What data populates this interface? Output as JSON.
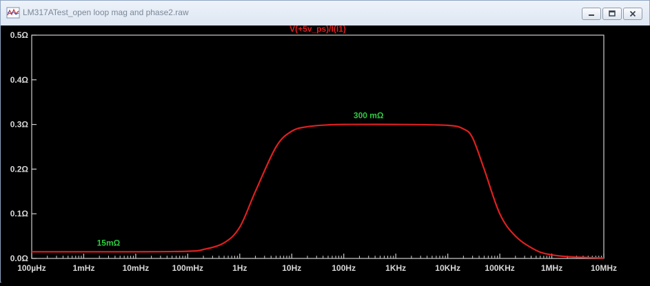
{
  "window": {
    "title": "LM317ATest_open loop mag and phase2.raw",
    "icons": {
      "app": "waveform-plot-icon",
      "minimize": "minimize-icon",
      "maximize": "maximize-icon",
      "close": "close-icon"
    }
  },
  "chart_data": {
    "type": "line",
    "title": "V(+5v_ps)/I(I1)",
    "xlabel": "",
    "ylabel": "",
    "x_scale": "log",
    "xlim": [
      0.0001,
      10000000
    ],
    "ylim": [
      0,
      0.5
    ],
    "grid": false,
    "x_ticks": [
      {
        "value": 0.0001,
        "label": "100µHz"
      },
      {
        "value": 0.001,
        "label": "1mHz"
      },
      {
        "value": 0.01,
        "label": "10mHz"
      },
      {
        "value": 0.1,
        "label": "100mHz"
      },
      {
        "value": 1,
        "label": "1Hz"
      },
      {
        "value": 10,
        "label": "10Hz"
      },
      {
        "value": 100,
        "label": "100Hz"
      },
      {
        "value": 1000,
        "label": "1KHz"
      },
      {
        "value": 10000,
        "label": "10KHz"
      },
      {
        "value": 100000,
        "label": "100KHz"
      },
      {
        "value": 1000000,
        "label": "1MHz"
      },
      {
        "value": 10000000,
        "label": "10MHz"
      }
    ],
    "y_ticks": [
      {
        "value": 0,
        "label": "0.0Ω"
      },
      {
        "value": 0.1,
        "label": "0.1Ω"
      },
      {
        "value": 0.2,
        "label": "0.2Ω"
      },
      {
        "value": 0.3,
        "label": "0.3Ω"
      },
      {
        "value": 0.4,
        "label": "0.4Ω"
      },
      {
        "value": 0.5,
        "label": "0.5Ω"
      }
    ],
    "series": [
      {
        "name": "V(+5v_ps)/I(I1)",
        "color": "#e02020",
        "x": [
          0.0001,
          0.001,
          0.01,
          0.1,
          0.2,
          0.5,
          1,
          2,
          5,
          10,
          20,
          50,
          100,
          1000,
          10000,
          20000,
          30000,
          50000,
          100000,
          200000,
          500000,
          1000000,
          2000000,
          5000000,
          10000000
        ],
        "y": [
          0.015,
          0.015,
          0.015,
          0.016,
          0.02,
          0.035,
          0.07,
          0.15,
          0.25,
          0.285,
          0.295,
          0.299,
          0.3,
          0.3,
          0.298,
          0.29,
          0.27,
          0.2,
          0.1,
          0.05,
          0.018,
          0.008,
          0.004,
          0.002,
          0.001
        ]
      }
    ],
    "annotations": [
      {
        "text": "15mΩ",
        "x": 0.003,
        "y": 0.015,
        "color": "#2ecc40"
      },
      {
        "text": "300 mΩ",
        "x": 300,
        "y": 0.3,
        "color": "#2ecc40"
      }
    ],
    "colors": {
      "background": "#000000",
      "axes": "#d0d0d0",
      "tick_labels": "#d8d8d8",
      "title": "#e02020"
    }
  }
}
